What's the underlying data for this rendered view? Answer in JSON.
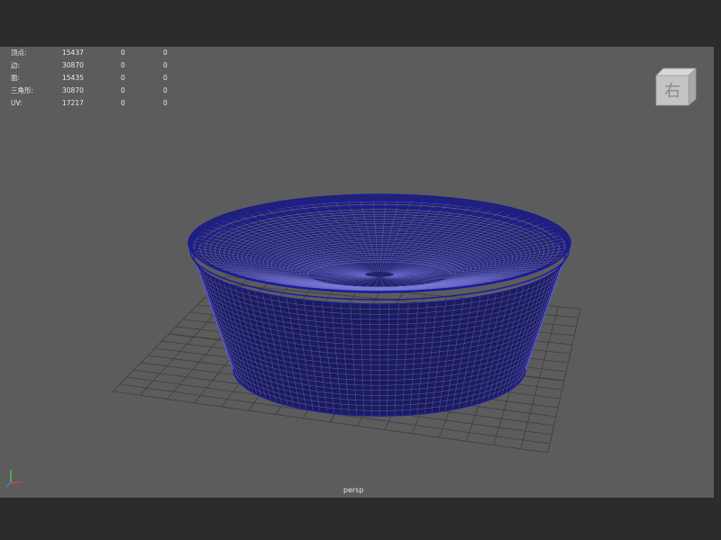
{
  "viewport": {
    "camera": "persp",
    "view_cube_face": "右"
  },
  "hud": {
    "rows": [
      {
        "label": "顶点:",
        "total": "15437",
        "selected": "0",
        "triangles": "0"
      },
      {
        "label": "边:",
        "total": "30870",
        "selected": "0",
        "triangles": "0"
      },
      {
        "label": "面:",
        "total": "15435",
        "selected": "0",
        "triangles": "0"
      },
      {
        "label": "三角形:",
        "total": "30870",
        "selected": "0",
        "triangles": "0"
      },
      {
        "label": "UV:",
        "total": "17217",
        "selected": "0",
        "triangles": "0"
      }
    ]
  },
  "colors": {
    "viewport_bg": "#5c5c5c",
    "grid": "#3e3e3e",
    "wireframe": "#1a1aa0",
    "frame": "#2c2c2c"
  },
  "icons": {
    "view_cube": "view-cube-icon",
    "axis": "axis-indicator-icon"
  }
}
